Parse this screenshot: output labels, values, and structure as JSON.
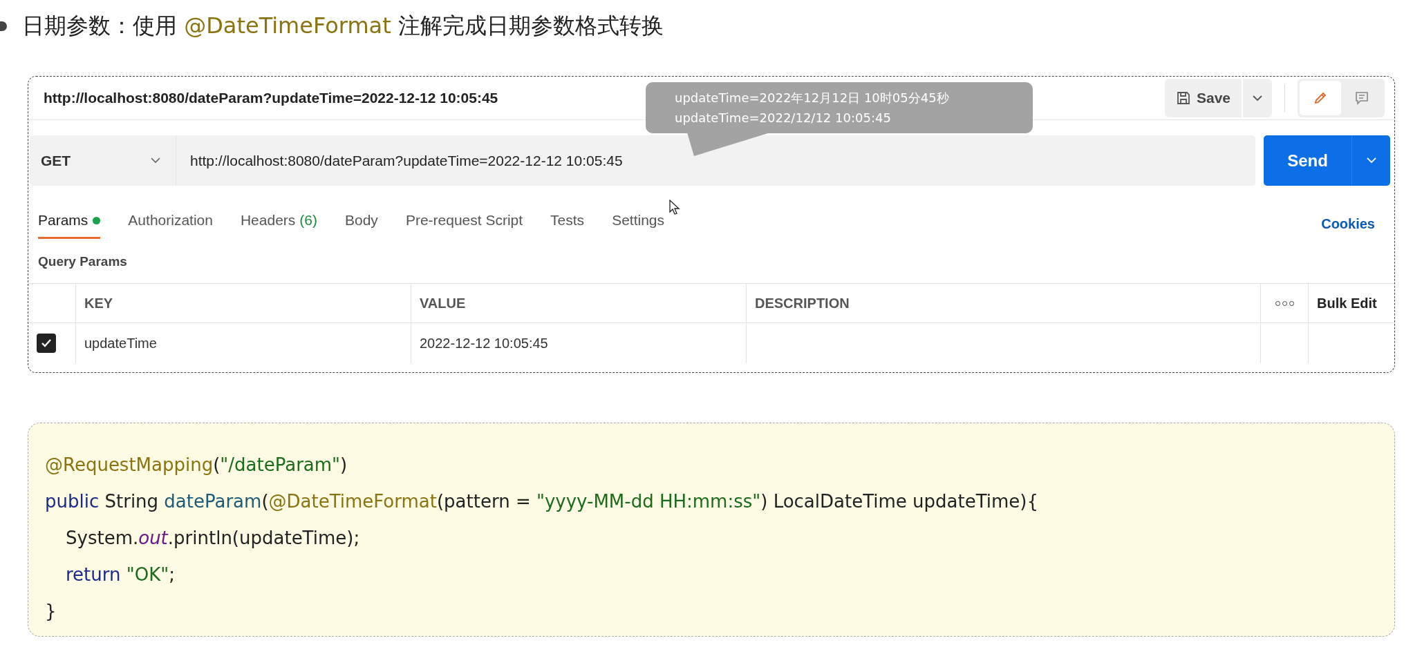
{
  "heading": {
    "parts": [
      {
        "kind": "plain",
        "text": "日期参数：使用 "
      },
      {
        "kind": "annotation",
        "text": "@DateTimeFormat"
      },
      {
        "kind": "plain",
        "text": " 注解完成日期参数格式转换"
      }
    ]
  },
  "request": {
    "title": "http://localhost:8080/dateParam?updateTime=2022-12-12 10:05:45",
    "save_label": "Save",
    "method": "GET",
    "url": "http://localhost:8080/dateParam?updateTime=2022-12-12 10:05:45",
    "send_label": "Send",
    "cookies_label": "Cookies",
    "tabs": [
      {
        "label": "Params",
        "dot": true,
        "selected": true
      },
      {
        "label": "Authorization",
        "dot": false,
        "selected": false
      },
      {
        "label": "Headers",
        "count": "(6)",
        "dot": false,
        "selected": false
      },
      {
        "label": "Body",
        "dot": false,
        "selected": false
      },
      {
        "label": "Pre-request Script",
        "dot": false,
        "selected": false
      },
      {
        "label": "Tests",
        "dot": false,
        "selected": false
      },
      {
        "label": "Settings",
        "dot": false,
        "selected": false
      }
    ],
    "section_label": "Query Params",
    "columns": [
      "KEY",
      "VALUE",
      "DESCRIPTION"
    ],
    "bulk_edit": "Bulk Edit",
    "rows": [
      {
        "checked": true,
        "key": "updateTime",
        "value": "2022-12-12 10:05:45"
      }
    ]
  },
  "callout": {
    "lines": [
      "updateTime=2022年12月12日 10时05分45秒",
      "updateTime=2022/12/12 10:05:45"
    ]
  },
  "code": {
    "lines": [
      {
        "indent": false,
        "tokens": [
          {
            "kind": "annotation",
            "text": "@RequestMapping"
          },
          {
            "kind": "plain",
            "text": "("
          },
          {
            "kind": "string",
            "text": "\"/dateParam\""
          },
          {
            "kind": "plain",
            "text": ")"
          }
        ]
      },
      {
        "indent": false,
        "tokens": [
          {
            "kind": "keyword",
            "text": "public"
          },
          {
            "kind": "plain",
            "text": " String "
          },
          {
            "kind": "method",
            "text": "dateParam"
          },
          {
            "kind": "plain",
            "text": "("
          },
          {
            "kind": "annotation",
            "text": "@DateTimeFormat"
          },
          {
            "kind": "plain",
            "text": "(pattern = "
          },
          {
            "kind": "string",
            "text": "\"yyyy-MM-dd HH:mm:ss\""
          },
          {
            "kind": "plain",
            "text": ") LocalDateTime updateTime){"
          }
        ]
      },
      {
        "indent": true,
        "tokens": [
          {
            "kind": "plain",
            "text": "System."
          },
          {
            "kind": "field",
            "text": "out"
          },
          {
            "kind": "plain",
            "text": ".println(updateTime);"
          }
        ]
      },
      {
        "indent": true,
        "tokens": [
          {
            "kind": "keyword",
            "text": "return"
          },
          {
            "kind": "string",
            "text": " \"OK\""
          },
          {
            "kind": "plain",
            "text": ";"
          }
        ]
      },
      {
        "indent": false,
        "tokens": [
          {
            "kind": "plain",
            "text": "}"
          }
        ]
      }
    ]
  }
}
